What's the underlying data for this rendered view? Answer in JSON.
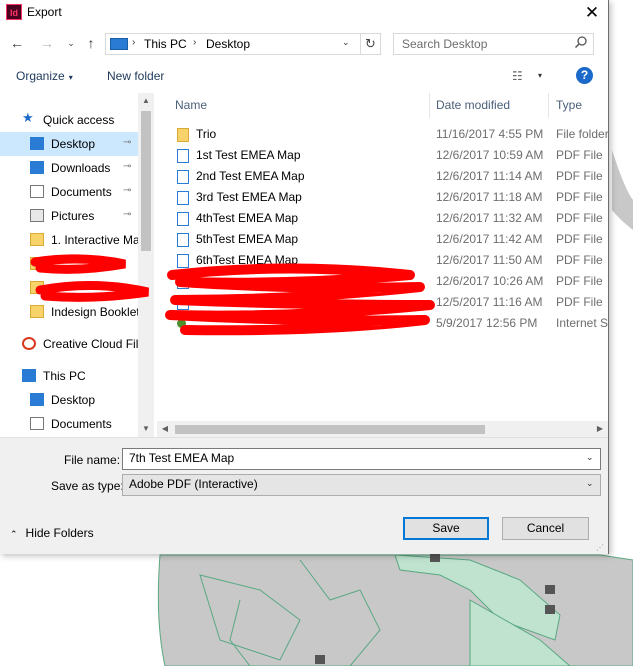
{
  "window": {
    "app_icon": "Id",
    "title": "Export",
    "close_glyph": "✕"
  },
  "navigation": {
    "back_glyph": "←",
    "forward_glyph": "→",
    "recent_glyph": "⌄",
    "up_glyph": "↑",
    "breadcrumbs": [
      "This PC",
      "Desktop"
    ],
    "separator": "›",
    "dropdown_glyph": "⌄",
    "refresh_glyph": "↻"
  },
  "search": {
    "placeholder": "Search Desktop",
    "icon": "search-icon"
  },
  "toolbar": {
    "organize_label": "Organize",
    "caret": "▾",
    "new_folder_label": "New folder",
    "view_glyph": "☷",
    "help_glyph": "?"
  },
  "nav_pane": {
    "items": [
      {
        "label": "Quick access",
        "icon": "star-icon"
      },
      {
        "label": "Desktop",
        "icon": "desktop-icon",
        "pinned": true,
        "selected": true
      },
      {
        "label": "Downloads",
        "icon": "download-icon",
        "pinned": true
      },
      {
        "label": "Documents",
        "icon": "documents-icon",
        "pinned": true
      },
      {
        "label": "Pictures",
        "icon": "pictures-icon",
        "pinned": true
      },
      {
        "label": "1. Interactive Ma",
        "icon": "folder-icon"
      },
      {
        "label": "",
        "icon": "folder-icon",
        "redacted": true
      },
      {
        "label": "",
        "icon": "folder-icon",
        "redacted": true
      },
      {
        "label": "Indesign Booklet",
        "icon": "folder-icon"
      },
      {
        "label": "Creative Cloud Fil",
        "icon": "creative-cloud-icon"
      },
      {
        "label": "This PC",
        "icon": "computer-icon"
      },
      {
        "label": "Desktop",
        "icon": "desktop-icon"
      },
      {
        "label": "Documents",
        "icon": "documents-icon"
      }
    ],
    "pin_glyph": "📌"
  },
  "file_list": {
    "columns": [
      "Name",
      "Date modified",
      "Type"
    ],
    "rows": [
      {
        "name": "Trio",
        "date": "11/16/2017 4:55 PM",
        "type": "File folder",
        "icon": "folder-icon"
      },
      {
        "name": "1st Test EMEA Map",
        "date": "12/6/2017 10:59 AM",
        "type": "PDF File",
        "icon": "pdf-icon"
      },
      {
        "name": "2nd Test EMEA Map",
        "date": "12/6/2017 11:14 AM",
        "type": "PDF File",
        "icon": "pdf-icon"
      },
      {
        "name": "3rd Test EMEA Map",
        "date": "12/6/2017 11:18 AM",
        "type": "PDF File",
        "icon": "pdf-icon"
      },
      {
        "name": "4thTest EMEA Map",
        "date": "12/6/2017 11:32 AM",
        "type": "PDF File",
        "icon": "pdf-icon"
      },
      {
        "name": "5thTest EMEA Map",
        "date": "12/6/2017 11:42 AM",
        "type": "PDF File",
        "icon": "pdf-icon"
      },
      {
        "name": "6thTest EMEA Map",
        "date": "12/6/2017 11:50 AM",
        "type": "PDF File",
        "icon": "pdf-icon"
      },
      {
        "name": "",
        "date": "12/6/2017 10:26 AM",
        "type": "PDF File",
        "icon": "pdf-icon",
        "redacted": true
      },
      {
        "name": "",
        "date": "12/5/2017 11:16 AM",
        "type": "PDF File",
        "icon": "pdf-icon",
        "redacted": true
      },
      {
        "name": "",
        "date": "5/9/2017 12:56 PM",
        "type": "Internet S",
        "icon": "web-icon",
        "redacted": true
      }
    ]
  },
  "form": {
    "filename_label": "File name:",
    "filename_value": "7th Test EMEA Map",
    "savetype_label": "Save as type:",
    "savetype_value": "Adobe PDF (Interactive)",
    "hide_folders_label": "Hide Folders",
    "hide_caret": "⌃",
    "save_label": "Save",
    "cancel_label": "Cancel",
    "grip_glyph": "⋰"
  },
  "colors": {
    "accent": "#0078d7",
    "selection": "#cce8ff",
    "redaction": "#ff0000",
    "map_land": "#c8c8c8",
    "map_green": "#bfe3cf"
  }
}
